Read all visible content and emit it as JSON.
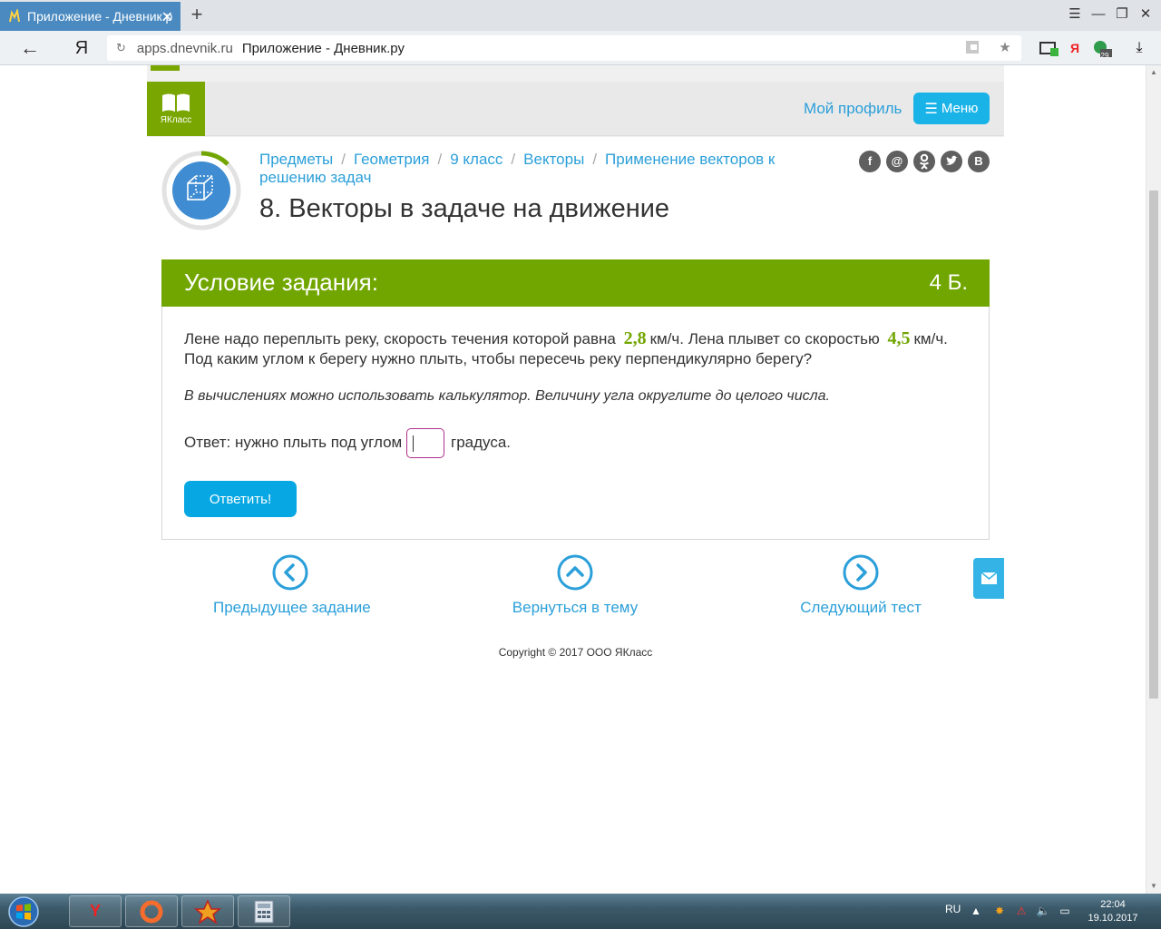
{
  "browser": {
    "tab_title": "Приложение - Дневник.р",
    "new_tab_label": "+",
    "back_glyph": "←",
    "yandex_letter": "Я",
    "reload_glyph": "↻",
    "url_domain": "apps.dnevnik.ru",
    "url_page_title": "Приложение - Дневник.ру",
    "extension_yandex_letter": "Я",
    "extension_badge_count": "29",
    "icons": [
      "menu-icon",
      "minimize-icon",
      "restore-icon",
      "close-icon",
      "bookmark-star-icon",
      "download-icon"
    ]
  },
  "site": {
    "logo_text": "ЯКласс",
    "profile_link": "Мой профиль",
    "menu_label": "Меню",
    "menu_glyph": "☰"
  },
  "breadcrumb": {
    "items": [
      "Предметы",
      "Геометрия",
      "9 класс",
      "Векторы",
      "Применение векторов к решению задач"
    ],
    "separator": "/"
  },
  "page_title": "8. Векторы в задаче на движение",
  "social": [
    "f",
    "@",
    "ok",
    "tw",
    "В"
  ],
  "task": {
    "header": "Условие задания:",
    "points": "4 Б.",
    "text_part1": "Лене надо переплыть реку, скорость течения которой равна",
    "current_speed": "2,8",
    "text_part2": "км/ч. Лена плывет со скоростью",
    "swim_speed": "4,5",
    "text_part3": "км/ч. Под каким углом к берегу нужно плыть, чтобы пересечь реку перпендикулярно берегу?",
    "hint": "В вычислениях можно использовать калькулятор. Величину угла округлите до целого числа.",
    "answer_prefix": "Ответ: нужно плыть под углом",
    "answer_value": "",
    "answer_suffix": "градуса.",
    "submit_label": "Ответить!"
  },
  "navigation": {
    "previous": "Предыдущее задание",
    "back_to_topic": "Вернуться в тему",
    "next": "Следующий тест"
  },
  "copyright": "Copyright © 2017 ООО ЯКласс",
  "taskbar": {
    "apps": [
      "yandex-browser",
      "origin",
      "app-3",
      "calculator"
    ],
    "yandex_letter": "Y",
    "language": "RU",
    "time": "22:04",
    "date": "19.10.2017"
  },
  "colors": {
    "yaklass_green": "#71a600",
    "link_blue": "#2b9fd9",
    "button_blue": "#06a7e2",
    "tab_blue": "#4a8ac0",
    "input_border": "#b0308a"
  }
}
